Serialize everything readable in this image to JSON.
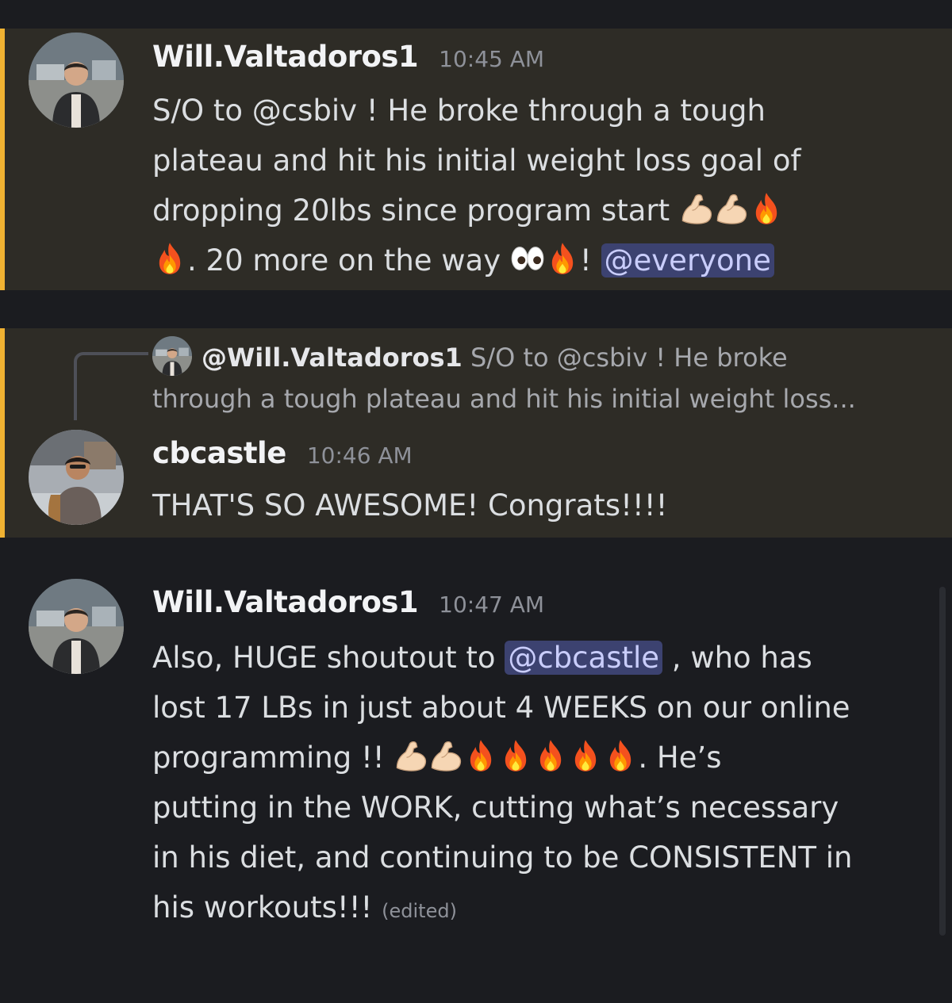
{
  "messages": [
    {
      "author": "Will.Valtadoros1",
      "time": "10:45 AM",
      "lines": [
        "S/O to @csbiv ! He broke through a tough",
        "plateau and hit his initial weight loss goal of",
        "dropping 20lbs since program start"
      ],
      "line4_a": ". 20 more on the way",
      "line4_b": "!",
      "mention": "@everyone"
    },
    {
      "reply": {
        "author": "@Will.Valtadoros1",
        "text_1": "S/O to @csbiv ! He broke",
        "text_2": "through a tough plateau and hit his initial weight loss..."
      },
      "author": "cbcastle",
      "time": "10:46 AM",
      "text": "THAT'S SO AWESOME! Congrats!!!!"
    },
    {
      "author": "Will.Valtadoros1",
      "time": "10:47 AM",
      "line1_a": "Also, HUGE shoutout to",
      "mention": "@cbcastle",
      "line1_b": ", who has",
      "line2": "lost 17 LBs in just about 4 WEEKS on our online",
      "line3_a": "programming !!",
      "line3_b": ".  He’s",
      "line4": "putting in the WORK, cutting what’s necessary",
      "line5": "in his diet, and continuing to be CONSISTENT in",
      "line6": "his workouts!!!",
      "edited": "(edited)"
    }
  ],
  "colors": {
    "background": "#1b1c20",
    "highlight_bg": "#2e2c26",
    "highlight_bar": "#f0b232",
    "mention_bg": "#3c4270",
    "mention_text": "#c9cdfb"
  },
  "icons": [
    "flexed-biceps-emoji",
    "fire-emoji",
    "eyes-emoji",
    "user-avatar"
  ]
}
